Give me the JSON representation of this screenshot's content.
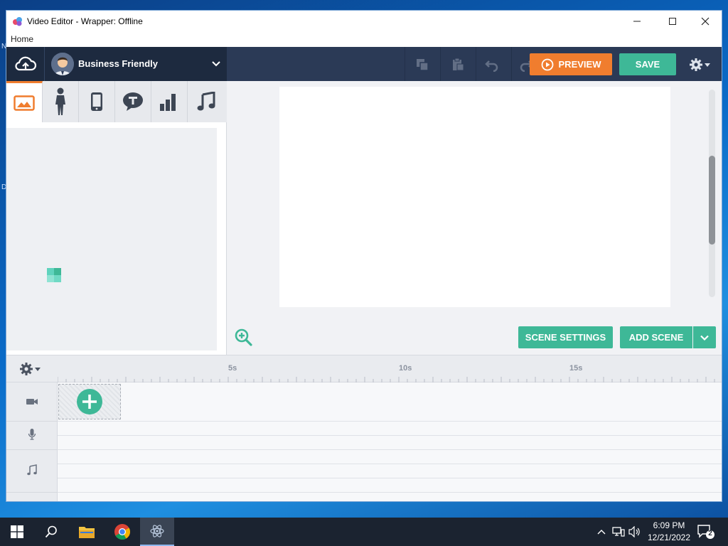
{
  "window": {
    "title": "Video Editor - Wrapper: Offline",
    "menu": [
      "Home"
    ]
  },
  "toolbar": {
    "theme_name": "Business Friendly",
    "preview_label": "PREVIEW",
    "save_label": "SAVE"
  },
  "stage": {
    "scene_settings_label": "SCENE SETTINGS",
    "add_scene_label": "ADD SCENE"
  },
  "timeline": {
    "ticks": [
      "5s",
      "10s",
      "15s"
    ]
  },
  "taskbar": {
    "time": "6:09 PM",
    "date": "12/21/2022",
    "notification_count": "2"
  },
  "colors": {
    "toolbar_bg": "#2b3a56",
    "accent_orange": "#f07d2e",
    "accent_green": "#3eb897"
  },
  "icons": {
    "asset_tabs": [
      "image-icon",
      "character-icon",
      "phone-prop-icon",
      "text-bubble-icon",
      "chart-icon",
      "music-icon"
    ],
    "tracks": [
      "video-camera-icon",
      "microphone-icon",
      "music-note-icon"
    ]
  }
}
